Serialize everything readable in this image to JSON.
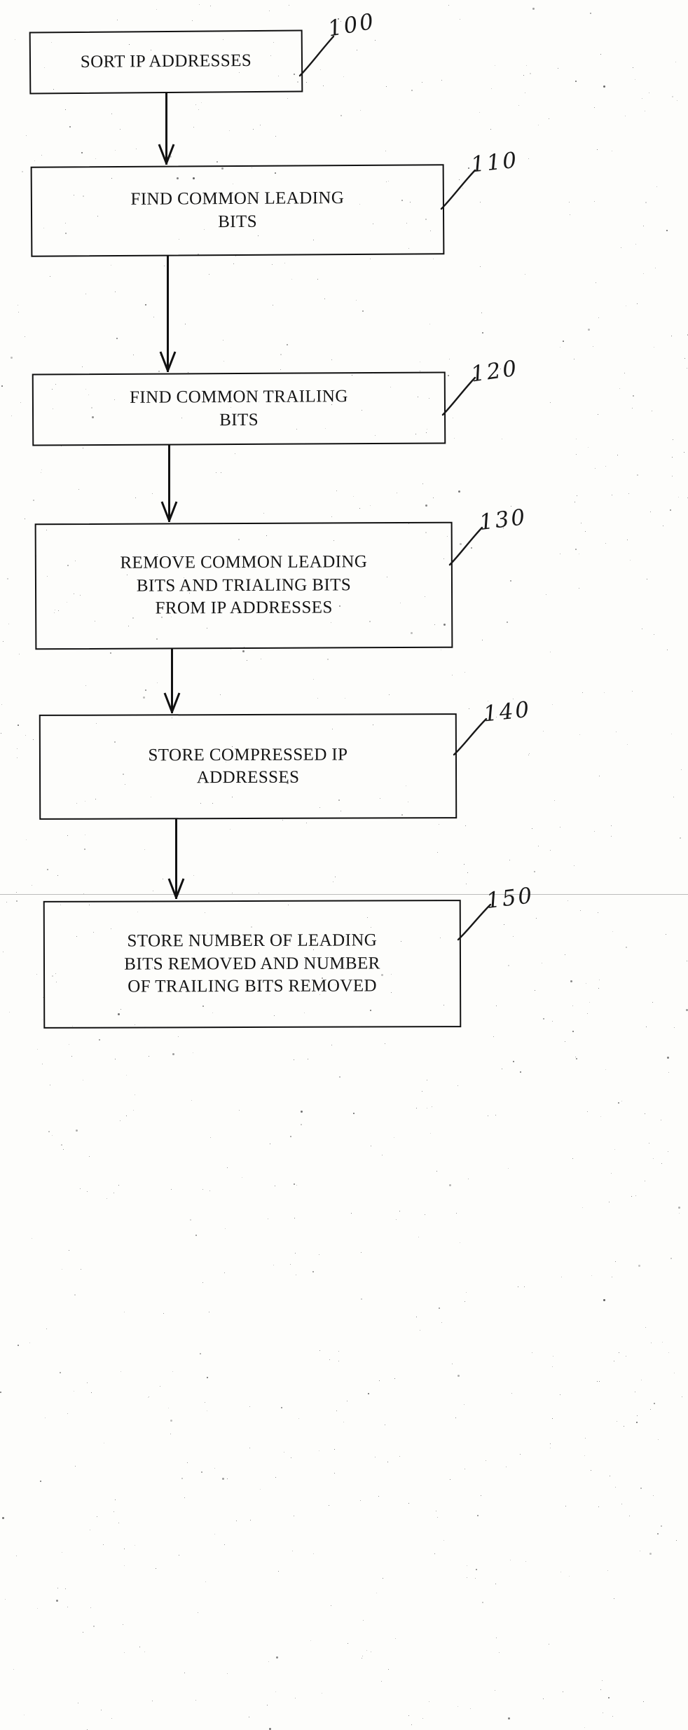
{
  "diagram": {
    "type": "flowchart",
    "orientation": "vertical",
    "title": "",
    "nodes": [
      {
        "id": "node-100",
        "ref": "100",
        "label": "SORT IP ADDRESSES",
        "shape": "rectangle"
      },
      {
        "id": "node-110",
        "ref": "110",
        "label": "FIND COMMON LEADING\nBITS",
        "shape": "rectangle"
      },
      {
        "id": "node-120",
        "ref": "120",
        "label": "FIND COMMON TRAILING\nBITS",
        "shape": "rectangle"
      },
      {
        "id": "node-130",
        "ref": "130",
        "label": "REMOVE COMMON LEADING\nBITS AND TRIALING BITS\nFROM IP ADDRESSES",
        "shape": "rectangle"
      },
      {
        "id": "node-140",
        "ref": "140",
        "label": "STORE COMPRESSED IP\nADDRESSES",
        "shape": "rectangle"
      },
      {
        "id": "node-150",
        "ref": "150",
        "label": "STORE NUMBER OF LEADING\nBITS REMOVED AND NUMBER\nOF TRAILING BITS REMOVED",
        "shape": "rectangle"
      }
    ],
    "edges": [
      {
        "id": "edge-100-110",
        "from": "100",
        "to": "110",
        "arrow": "down"
      },
      {
        "id": "edge-110-120",
        "from": "110",
        "to": "120",
        "arrow": "down"
      },
      {
        "id": "edge-120-130",
        "from": "120",
        "to": "130",
        "arrow": "down"
      },
      {
        "id": "edge-130-140",
        "from": "130",
        "to": "140",
        "arrow": "down"
      },
      {
        "id": "edge-140-150",
        "from": "140",
        "to": "150",
        "arrow": "down"
      }
    ],
    "colors": {
      "ink": "#111111",
      "paper": "#fdfdfb"
    }
  }
}
